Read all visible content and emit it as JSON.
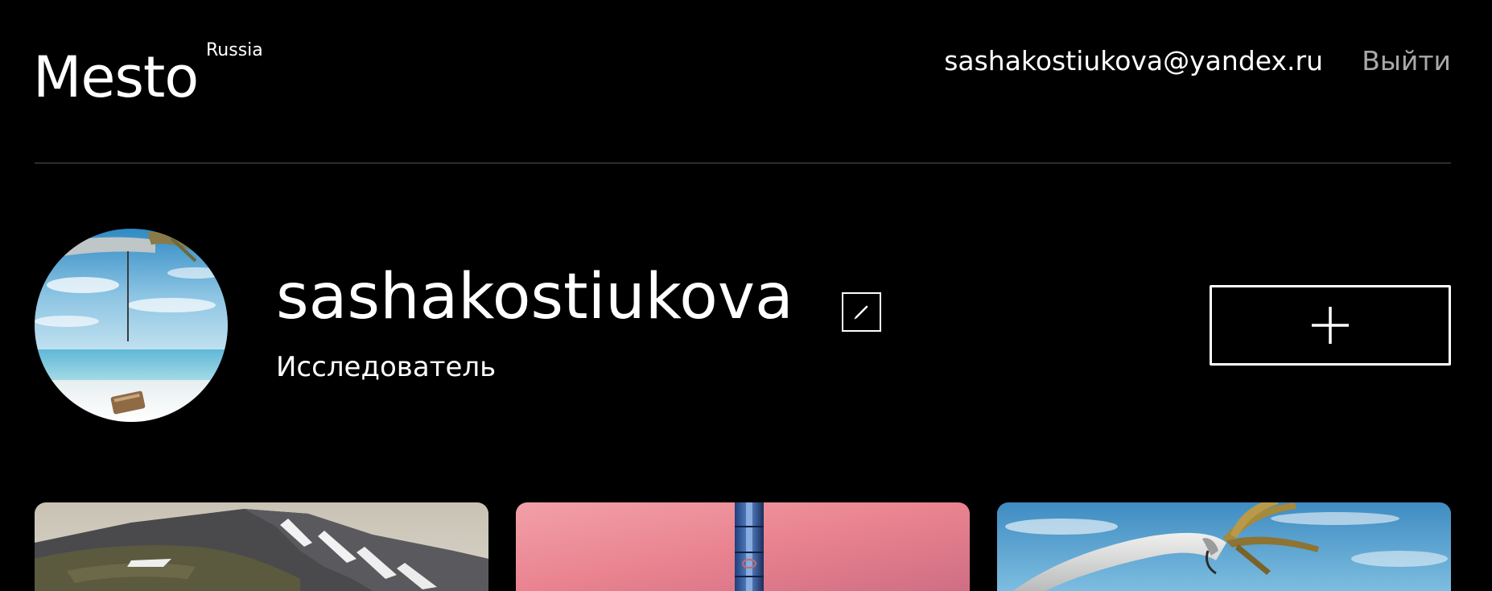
{
  "header": {
    "logo": "Mesto",
    "logo_superscript": "Russia",
    "user_email": "sashakostiukova@yandex.ru",
    "logout_label": "Выйти"
  },
  "profile": {
    "avatar_description": "avatar photo",
    "name": "sashakostiukova",
    "about": "Исследователь",
    "edit_icon": "pencil-icon",
    "add_icon": "plus-icon"
  },
  "cards": [
    {
      "image": "mountain-landscape"
    },
    {
      "image": "tower-at-sunset"
    },
    {
      "image": "palm-tree-beach"
    }
  ],
  "colors": {
    "background": "#000000",
    "text": "#ffffff",
    "logout": "#a9a9a9",
    "divider": "#545454"
  }
}
